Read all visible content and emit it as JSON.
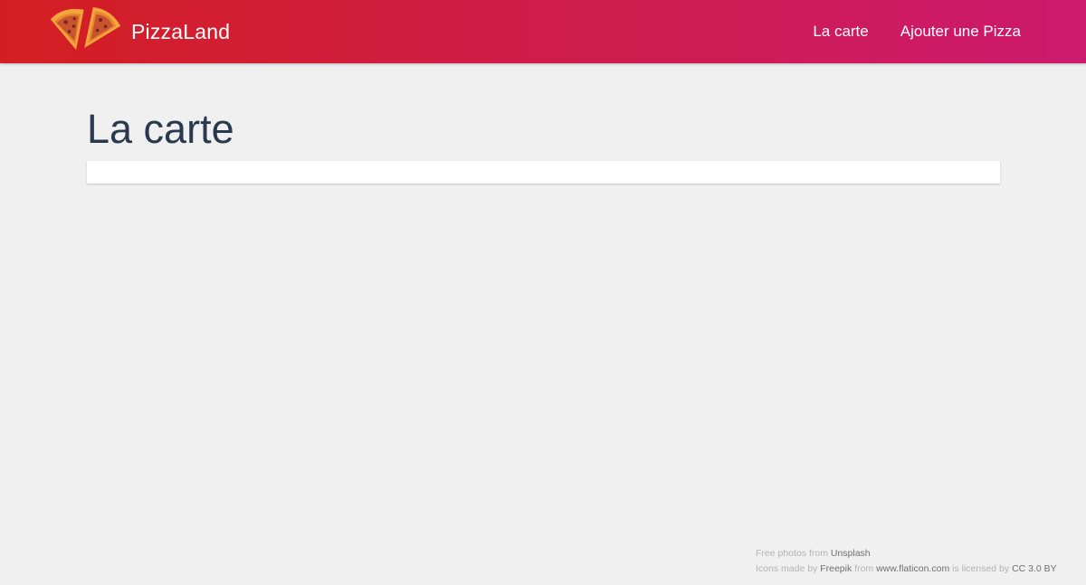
{
  "header": {
    "brand_name": "PizzaLand",
    "logo_icon": "pizza-slices-icon",
    "nav": [
      {
        "label": "La carte"
      },
      {
        "label": "Ajouter une Pizza"
      }
    ],
    "gradient_colors": [
      "#d41f22",
      "#cc1a6e"
    ]
  },
  "main": {
    "title": "La carte"
  },
  "footer": {
    "photos_prefix": "Free photos from",
    "photos_link": "Unsplash",
    "icons_prefix": "Icons made by",
    "icons_author": "Freepik",
    "icons_from": "from",
    "icons_site": "www.flaticon.com",
    "icons_licensed": "is licensed by",
    "icons_license": "CC 3.0 BY"
  }
}
